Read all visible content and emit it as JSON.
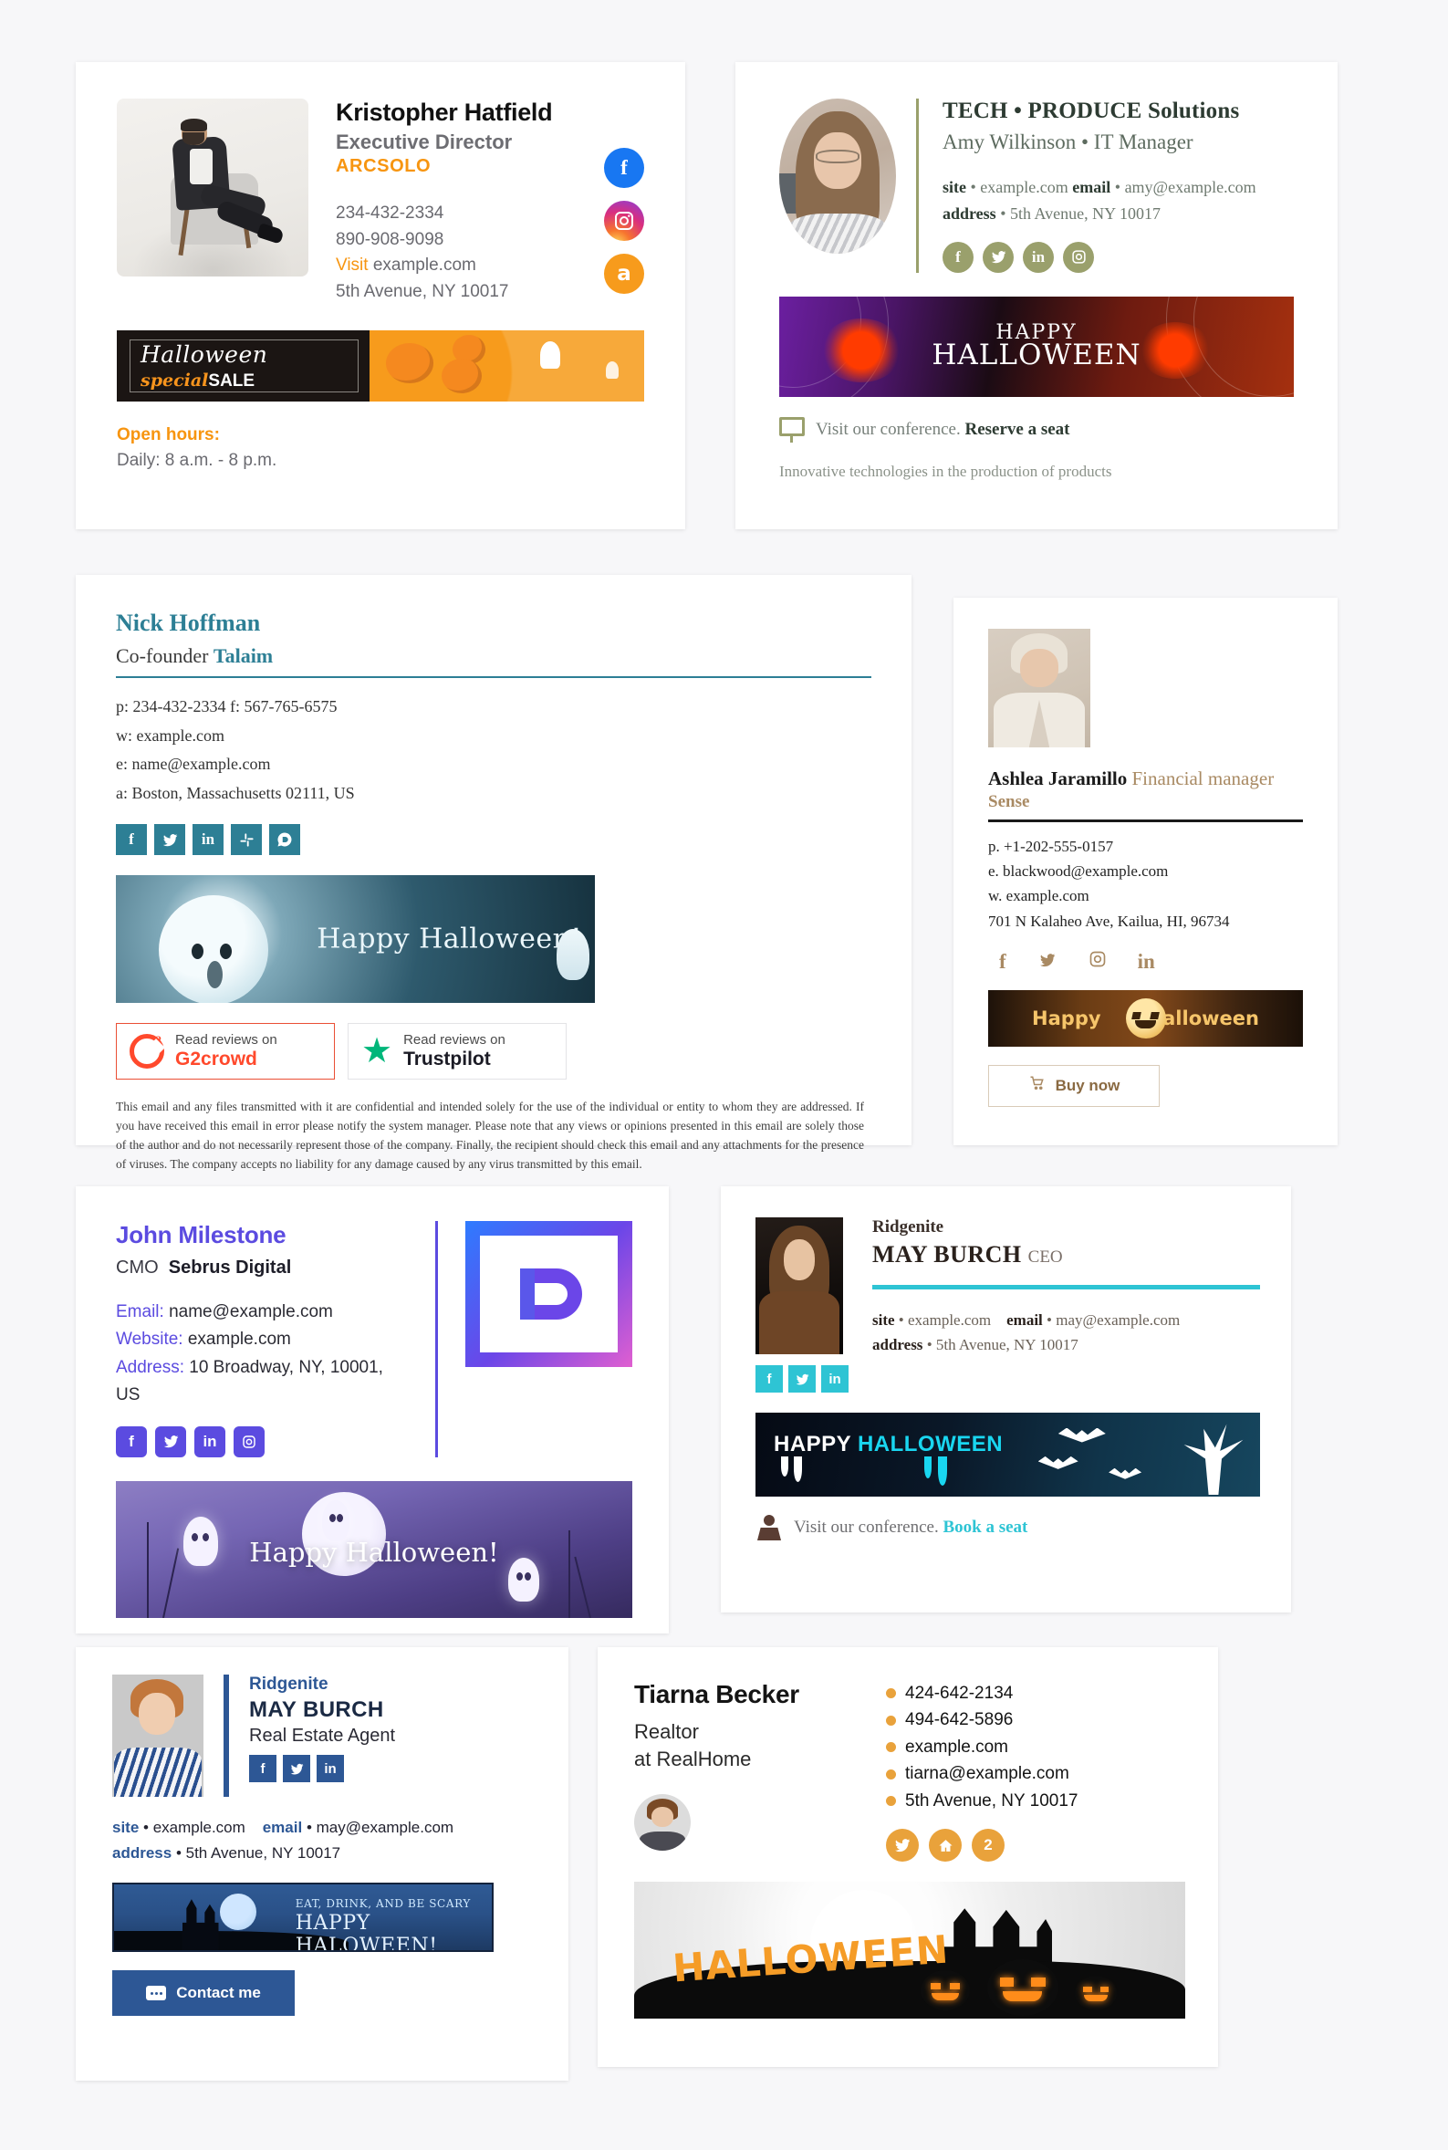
{
  "cards": [
    {
      "id": "kristopher",
      "name": "Kristopher Hatfield",
      "role": "Executive Director",
      "company": "ARCSOLO",
      "phone1": "234-432-2334",
      "phone2": "890-908-9098",
      "visit_label": "Visit",
      "website": "example.com",
      "address": "5th Avenue, NY 10017",
      "social": [
        "facebook-icon",
        "instagram-icon",
        "amazon-icon"
      ],
      "banner": {
        "headline": "Halloween",
        "sub_special": "special",
        "sub_sale": "SALE"
      },
      "hours_title": "Open hours:",
      "hours_value": "Daily: 8 a.m. - 8 p.m."
    },
    {
      "id": "tech-produce",
      "company": "TECH • PRODUCE Solutions",
      "person": "Amy Wilkinson • IT Manager",
      "site_label": "site",
      "site_value": "• example.com",
      "email_label": "email",
      "email_value": "• amy@example.com",
      "address_label": "address",
      "address_value": "• 5th Avenue, NY 10017",
      "social": [
        "facebook-icon",
        "twitter-icon",
        "linkedin-icon",
        "instagram-icon"
      ],
      "banner": {
        "line1": "HAPPY",
        "line2": "HALLOWEEN"
      },
      "cta_text": "Visit our conference.",
      "cta_link": "Reserve a seat",
      "tagline": "Innovative technologies in the production of products"
    },
    {
      "id": "nick-hoffman",
      "name": "Nick Hoffman",
      "role": "Co-founder",
      "company": "Talaim",
      "line_phone": "p: 234-432-2334 f: 567-765-6575",
      "line_web": "w: example.com",
      "line_email": "e: name@example.com",
      "line_addr": "a: Boston, Massachusetts 02111, US",
      "social": [
        "facebook-icon",
        "twitter-icon",
        "linkedin-icon",
        "slack-icon",
        "disqus-icon"
      ],
      "banner_text": "Happy Halloween!",
      "reviews": [
        {
          "top": "Read reviews on",
          "brand": "G2crowd",
          "icon": "g2crowd-icon"
        },
        {
          "top": "Read reviews on",
          "brand": "Trustpilot",
          "icon": "trustpilot-star-icon"
        }
      ],
      "disclaimer": "This email and any files transmitted with it are confidential and intended solely for the use of the individual or entity to whom they are addressed. If you have received this email in error please notify the system manager. Please note that any views or opinions presented in this email are solely those of the author and do not necessarily represent those of the company. Finally, the recipient should check this email and any attachments for the presence of viruses. The company accepts no liability for any damage caused by any virus transmitted by this email."
    },
    {
      "id": "ashlea-jaramillo",
      "name": "Ashlea Jaramillo",
      "role": "Financial manager",
      "company": "Sense",
      "line_phone": "p. +1-202-555-0157",
      "line_email": "e. blackwood@example.com",
      "line_web": "w. example.com",
      "line_addr": "701 N Kalaheo Ave, Kailua, HI, 96734",
      "social": [
        "facebook-icon",
        "twitter-icon",
        "instagram-icon",
        "linkedin-icon"
      ],
      "banner_left": "Happy",
      "banner_right": "Halloween",
      "buy_label": "Buy now",
      "buy_icon": "shopping-cart-icon"
    },
    {
      "id": "john-milestone",
      "name": "John Milestone",
      "role": "CMO",
      "company": "Sebrus Digital",
      "email_label": "Email:",
      "email_value": "name@example.com",
      "website_label": "Website:",
      "website_value": "example.com",
      "address_label": "Address:",
      "address_value": "10 Broadway, NY, 10001, US",
      "social": [
        "facebook-icon",
        "twitter-icon",
        "linkedin-icon",
        "instagram-icon"
      ],
      "logo": "letter-d-logo",
      "banner_text": "Happy Halloween!"
    },
    {
      "id": "may-burch-ceo",
      "company": "Ridgenite",
      "name": "MAY BURCH",
      "role": "CEO",
      "site_label": "site",
      "site_value": "• example.com",
      "email_label": "email",
      "email_value": "• may@example.com",
      "address_label": "address",
      "address_value": "• 5th Avenue, NY 10017",
      "social": [
        "facebook-icon",
        "twitter-icon",
        "linkedin-icon"
      ],
      "banner_happy": "HAPPY",
      "banner_halloween": "HALLOWEEN",
      "cta_text": "Visit our conference.",
      "cta_link": "Book a seat"
    },
    {
      "id": "may-burch-agent",
      "company": "Ridgenite",
      "name": "MAY BURCH",
      "role": "Real Estate Agent",
      "social": [
        "facebook-icon",
        "twitter-icon",
        "linkedin-icon"
      ],
      "site_label": "site",
      "site_value": "• example.com",
      "email_label": "email",
      "email_value": "• may@example.com",
      "address_label": "address",
      "address_value": "• 5th Avenue, NY 10017",
      "banner_top": "EAT, DRINK, AND BE SCARY",
      "banner_main": "HAPPY HALOWEEN!",
      "button_label": "Contact me",
      "button_icon": "chat-bubble-icon"
    },
    {
      "id": "tiarna-becker",
      "name": "Tiarna Becker",
      "role_line1": "Realtor",
      "role_line2": "at RealHome",
      "contacts": [
        "424-642-2134",
        "494-642-5896",
        "example.com",
        "tiarna@example.com",
        "5th Avenue, NY 10017"
      ],
      "social": [
        "twitter-icon",
        "house-icon",
        "houzz-icon"
      ],
      "banner_text": "HALLOWEEN"
    }
  ],
  "colors": {
    "card1_accent": "#f79510",
    "card2_accent": "#9aa06c",
    "card3_accent": "#2d7f95",
    "card4_accent": "#a98a63",
    "card5_accent": "#5b4be0",
    "card6_accent": "#2ec4d4",
    "card7_accent": "#2d5795",
    "card8_accent": "#e9a23b",
    "page_bg": "#f7f7f9"
  }
}
